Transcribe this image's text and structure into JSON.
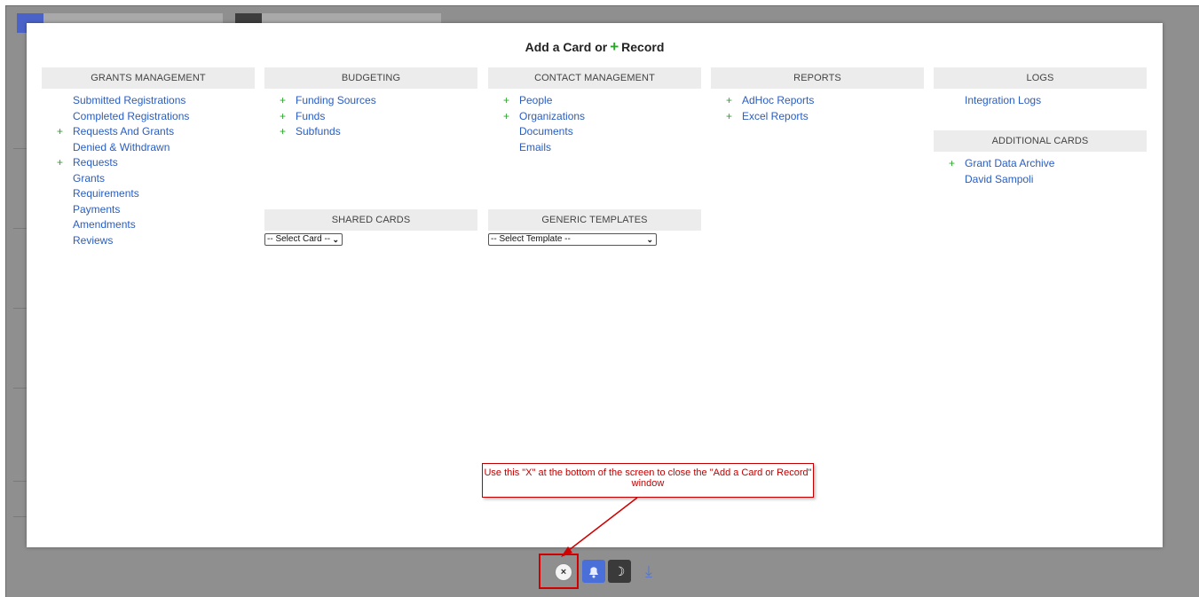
{
  "modal": {
    "title_prefix": "Add a Card or",
    "title_plus": "+",
    "title_suffix": "Record"
  },
  "sections": {
    "grants": {
      "header": "GRANTS MANAGEMENT",
      "items": [
        {
          "label": "Submitted Registrations",
          "plus": false
        },
        {
          "label": "Completed Registrations",
          "plus": false
        },
        {
          "label": "Requests And Grants",
          "plus": true
        },
        {
          "label": "Denied & Withdrawn",
          "plus": false
        },
        {
          "label": "Requests",
          "plus": true
        },
        {
          "label": "Grants",
          "plus": false
        },
        {
          "label": "Requirements",
          "plus": false
        },
        {
          "label": "Payments",
          "plus": false
        },
        {
          "label": "Amendments",
          "plus": false
        },
        {
          "label": "Reviews",
          "plus": false
        }
      ]
    },
    "budgeting": {
      "header": "BUDGETING",
      "items": [
        {
          "label": "Funding Sources",
          "plus": true
        },
        {
          "label": "Funds",
          "plus": true
        },
        {
          "label": "Subfunds",
          "plus": true
        }
      ]
    },
    "contact": {
      "header": "CONTACT MANAGEMENT",
      "items": [
        {
          "label": "People",
          "plus": true
        },
        {
          "label": "Organizations",
          "plus": true
        },
        {
          "label": "Documents",
          "plus": false
        },
        {
          "label": "Emails",
          "plus": false
        }
      ]
    },
    "reports": {
      "header": "REPORTS",
      "items": [
        {
          "label": "AdHoc Reports",
          "plus": true
        },
        {
          "label": "Excel Reports",
          "plus": true
        }
      ]
    },
    "logs": {
      "header": "LOGS",
      "items": [
        {
          "label": "Integration Logs",
          "plus": false
        }
      ]
    },
    "additional": {
      "header": "ADDITIONAL CARDS",
      "items": [
        {
          "label": "Grant Data Archive",
          "plus": true
        },
        {
          "label": "David Sampoli",
          "plus": false
        }
      ]
    },
    "shared": {
      "header": "SHARED CARDS",
      "select_value": "-- Select Card --"
    },
    "generic": {
      "header": "GENERIC TEMPLATES",
      "select_value": "-- Select Template --"
    }
  },
  "annotation": {
    "text": "Use this \"X\" at the bottom of the screen to close the \"Add a Card or Record\" window"
  },
  "toolbar": {
    "close_glyph": "×",
    "moon_glyph": "☽",
    "download_glyph": "⤓"
  },
  "colors": {
    "link": "#2a5dbf",
    "plus": "#2aa52a",
    "annotation": "#c00000"
  }
}
